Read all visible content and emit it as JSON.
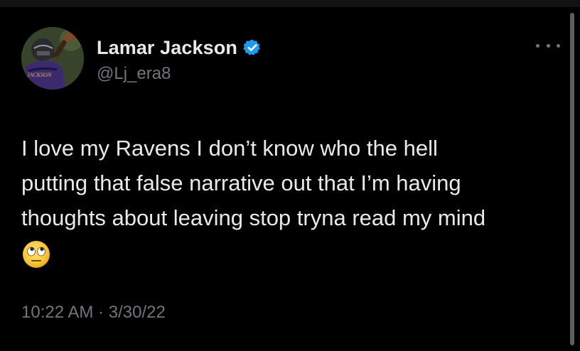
{
  "tweet": {
    "author": {
      "display_name": "Lamar Jackson",
      "handle": "@Lj_era8",
      "verified": true,
      "avatar_icon": "profile-photo-avatar",
      "avatar_jersey_text": "JACKSON"
    },
    "text_lines": [
      "I love my Ravens I don’t know who the hell",
      "putting that false narrative out that I’m having",
      "thoughts about leaving stop tryna read my mind"
    ],
    "emoji": "face-with-rolling-eyes",
    "timestamp": "10:22 AM · 3/30/22",
    "more_icon": "more-options-icon"
  },
  "colors": {
    "background": "#000000",
    "primary_text": "#e7e9ea",
    "secondary_text": "#71767b",
    "verified_badge": "#1d9bf0"
  }
}
